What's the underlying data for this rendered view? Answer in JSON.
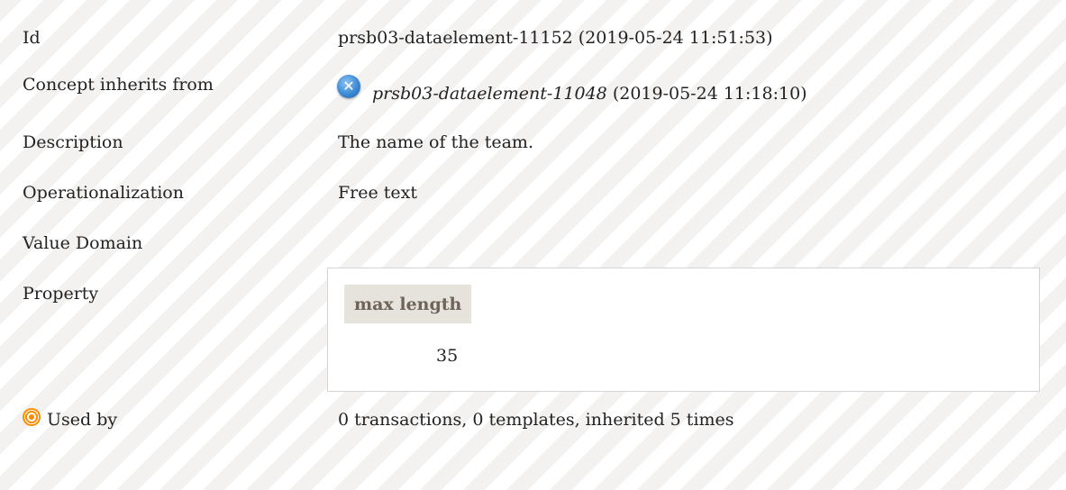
{
  "rows": {
    "id": {
      "label": "Id",
      "value": "prsb03-dataelement-11152 (2019-05-24 11:51:53)"
    },
    "inherits": {
      "label": "Concept inherits from",
      "link": "prsb03-dataelement-11048",
      "date": " (2019-05-24 11:18:10)",
      "icon": "cancel-circle-icon"
    },
    "description": {
      "label": "Description",
      "value": "The name of the team."
    },
    "operationalization": {
      "label": "Operationalization",
      "value": "Free text"
    },
    "value_domain": {
      "label": "Value Domain"
    },
    "property": {
      "label": "Property",
      "header": "max length",
      "value": "35"
    },
    "used_by": {
      "label": "Used by",
      "value": "0 transactions, 0 templates, inherited 5 times",
      "icon": "target-icon"
    }
  },
  "colors": {
    "stripe_dark": "#f3f2f1",
    "stripe_light": "#ffffff",
    "header_bg": "#e6e2dc",
    "header_text": "#6e6459",
    "icon_blue": "#3a8ad6",
    "icon_orange": "#ff8c00"
  }
}
